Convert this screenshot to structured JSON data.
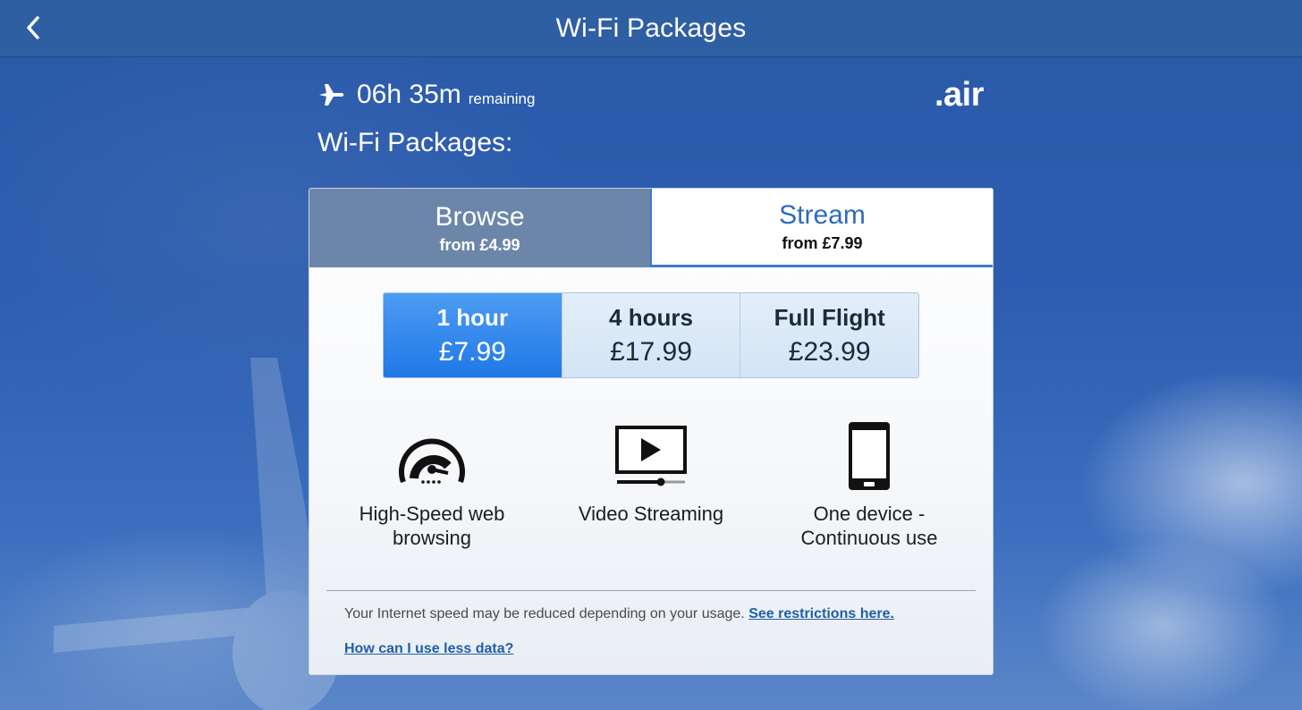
{
  "header": {
    "title": "Wi-Fi Packages",
    "back_icon": "chevron-left-icon"
  },
  "status": {
    "plane_icon": "airplane-icon",
    "time_remaining": "06h 35m",
    "remaining_label": "remaining",
    "brand": ".air"
  },
  "page_heading": "Wi-Fi Packages:",
  "tabs": [
    {
      "name": "Browse",
      "price": "from £4.99",
      "selected": false
    },
    {
      "name": "Stream",
      "price": "from £7.99",
      "selected": true
    }
  ],
  "options": [
    {
      "label": "1 hour",
      "price": "£7.99",
      "selected": true
    },
    {
      "label": "4 hours",
      "price": "£17.99",
      "selected": false
    },
    {
      "label": "Full Flight",
      "price": "£23.99",
      "selected": false
    }
  ],
  "features": [
    {
      "icon": "speedometer-icon",
      "line1": "High-Speed web",
      "line2": "browsing"
    },
    {
      "icon": "video-player-icon",
      "line1": "Video Streaming",
      "line2": ""
    },
    {
      "icon": "smartphone-icon",
      "line1": "One device -",
      "line2": "Continuous use"
    }
  ],
  "footer": {
    "note": "Your Internet speed may be reduced depending on your usage.",
    "restrictions_link": "See restrictions here.",
    "less_data_link": "How can I use less data?"
  },
  "colors": {
    "accent": "#2078e6",
    "header": "#2f5fa3",
    "link": "#1f5fa9"
  }
}
